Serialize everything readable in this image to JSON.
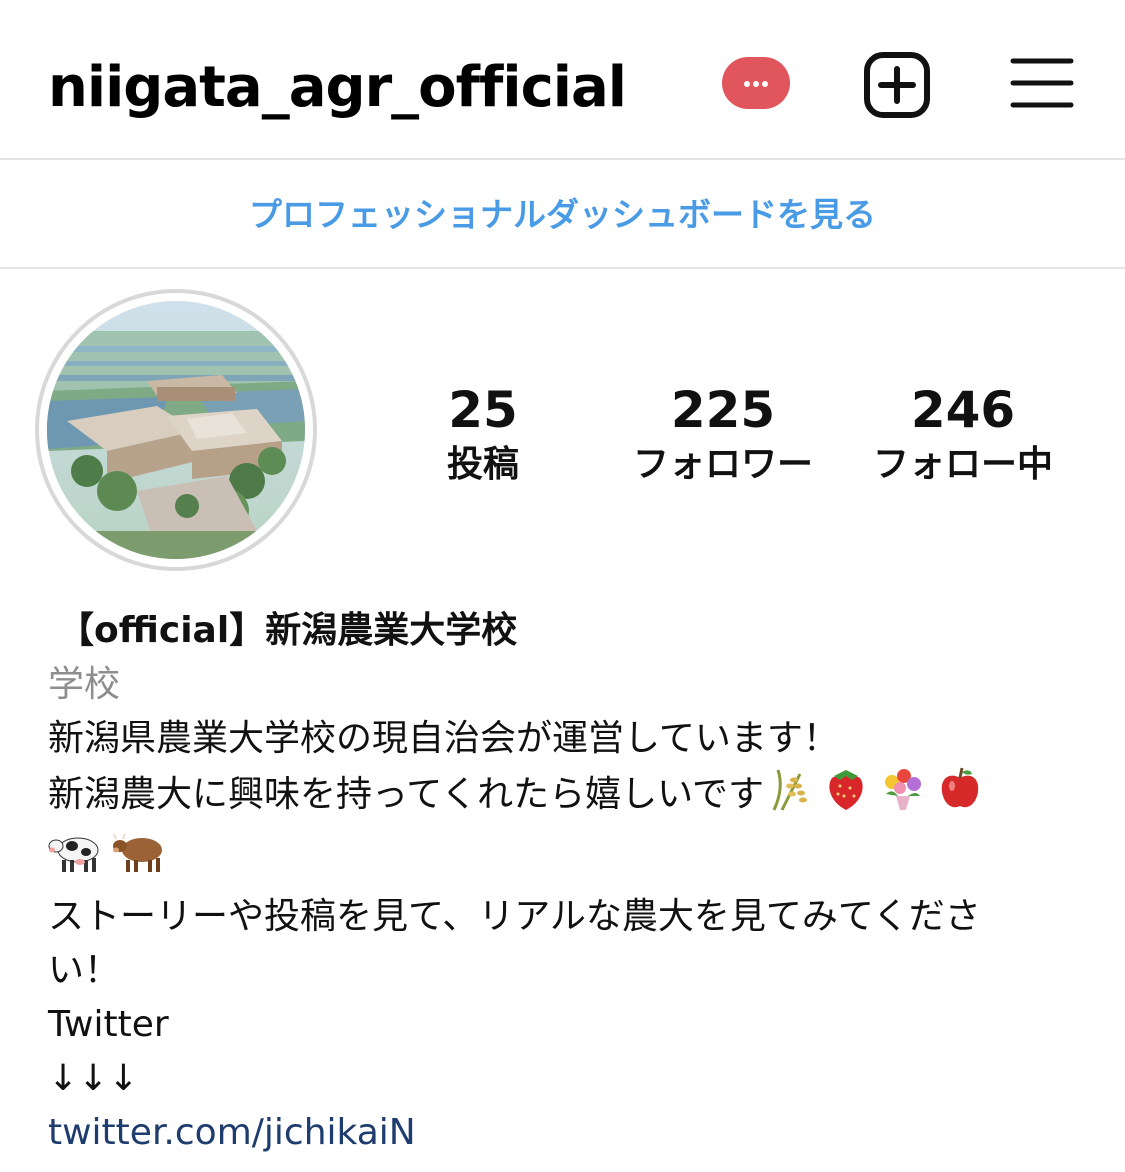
{
  "header": {
    "username": "niigata_agr_official",
    "badge": "notification-badge",
    "add_icon": "add-post-icon",
    "menu_icon": "hamburger-menu-icon"
  },
  "dashboard": {
    "label": "プロフェッショナルダッシュボードを見る"
  },
  "stats": {
    "posts": {
      "count": "25",
      "label": "投稿"
    },
    "followers": {
      "count": "225",
      "label": "フォロワー"
    },
    "following": {
      "count": "246",
      "label": "フォロー中"
    }
  },
  "bio": {
    "name": "【official】新潟農業大学校",
    "category": "学校",
    "line1": "新潟県農業大学校の現自治会が運営しています！",
    "line2": "新潟農大に興味を持ってくれたら嬉しいです",
    "line2_emojis": [
      "rice-emoji",
      "strawberry-emoji",
      "bouquet-emoji",
      "apple-emoji"
    ],
    "line3_emojis": [
      "dairy-cow-emoji",
      "brown-cow-emoji"
    ],
    "line4": "ストーリーや投稿を見て、リアルな農大を見てみてくださ",
    "line5": "い！",
    "line6": "Twitter",
    "line7": "↓↓↓",
    "link": "twitter.com/jichikaiN"
  },
  "colors": {
    "accent_blue": "#4a9be6",
    "link_navy": "#1f3c6e",
    "badge_red": "#e0565c",
    "muted_gray": "#8e8e8e"
  }
}
